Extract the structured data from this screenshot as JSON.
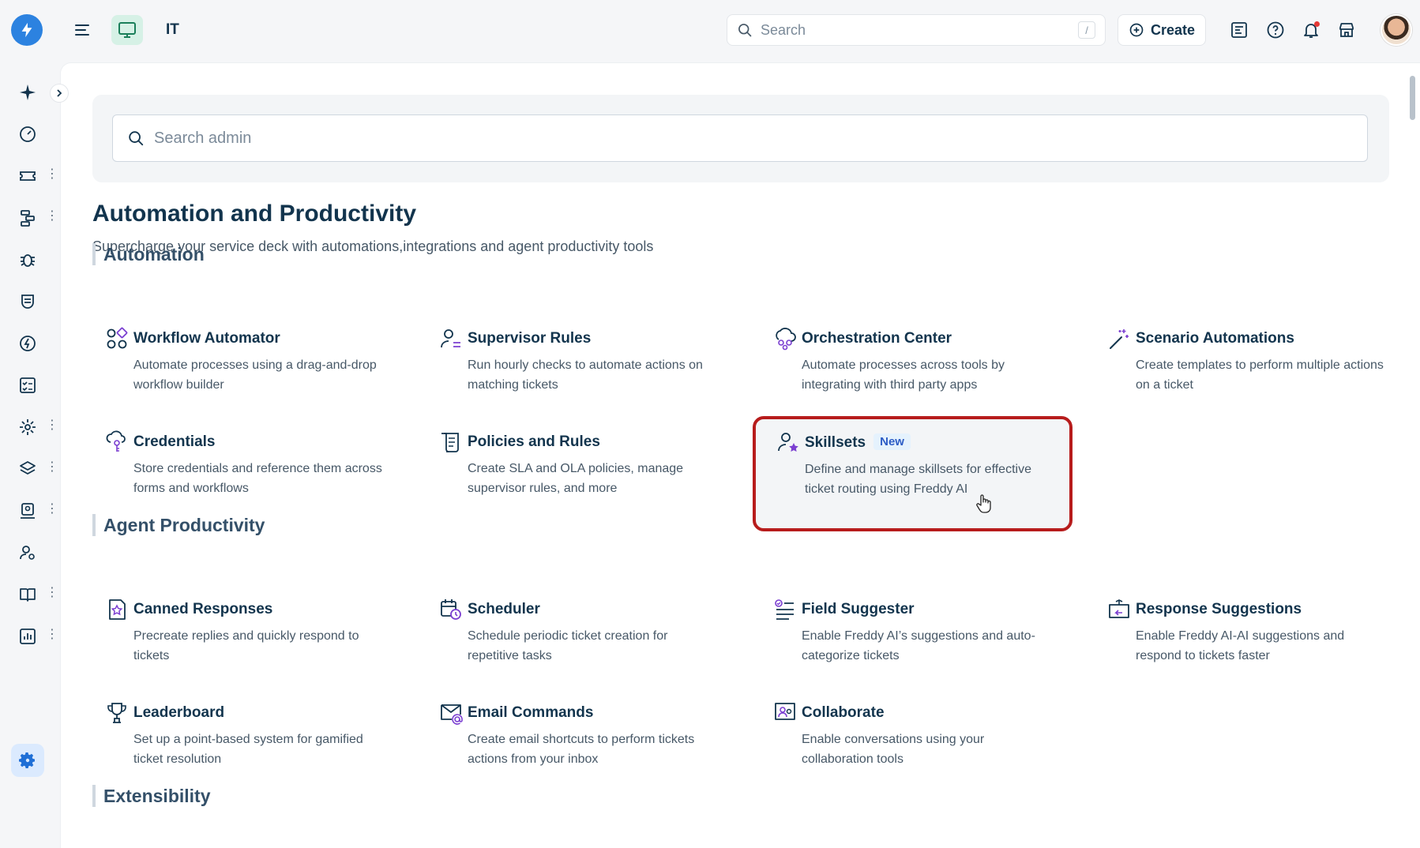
{
  "header": {
    "workspace_label": "IT",
    "search_placeholder": "Search",
    "search_shortcut": "/",
    "create_label": "Create"
  },
  "admin_search": {
    "placeholder": "Search admin"
  },
  "page": {
    "title": "Automation and Productivity",
    "subtitle": "Supercharge your service deck with automations,integrations and agent productivity tools"
  },
  "sections": {
    "automation": "Automation",
    "agent_productivity": "Agent Productivity",
    "extensibility": "Extensibility"
  },
  "automation_cards": [
    {
      "name": "Workflow Automator",
      "desc": "Automate processes using a drag-and-drop workflow builder",
      "icon": "workflow-icon"
    },
    {
      "name": "Supervisor Rules",
      "desc": "Run hourly checks to automate actions on matching tickets",
      "icon": "supervisor-icon"
    },
    {
      "name": "Orchestration Center",
      "desc": "Automate processes across tools by integrating with third party apps",
      "icon": "orchestration-icon"
    },
    {
      "name": "Scenario Automations",
      "desc": "Create templates to perform multiple actions on a ticket",
      "icon": "magic-wand-icon"
    },
    {
      "name": "Credentials",
      "desc": "Store credentials and reference them across forms and workflows",
      "icon": "credentials-icon"
    },
    {
      "name": "Policies and Rules",
      "desc": "Create SLA and OLA policies, manage supervisor rules, and more",
      "icon": "scroll-icon"
    },
    {
      "name": "Skillsets",
      "badge": "New",
      "desc": "Define and manage skillsets for effective ticket routing using Freddy AI",
      "icon": "skillset-icon"
    }
  ],
  "productivity_cards": [
    {
      "name": "Canned Responses",
      "desc": "Precreate replies and quickly respond to tickets",
      "icon": "canned-response-icon"
    },
    {
      "name": "Scheduler",
      "desc": "Schedule periodic ticket creation for repetitive tasks",
      "icon": "calendar-clock-icon"
    },
    {
      "name": "Field Suggester",
      "desc": "Enable Freddy AI’s suggestions and auto-categorize tickets",
      "icon": "field-suggester-icon"
    },
    {
      "name": "Response Suggestions",
      "desc": "Enable Freddy AI-AI suggestions and respond to tickets faster",
      "icon": "response-suggestion-icon"
    },
    {
      "name": "Leaderboard",
      "desc": "Set up a point-based system for gamified ticket resolution",
      "icon": "trophy-icon"
    },
    {
      "name": "Email Commands",
      "desc": "Create email shortcuts to perform tickets actions from your inbox",
      "icon": "email-command-icon"
    },
    {
      "name": "Collaborate",
      "desc": "Enable conversations using your collaboration tools",
      "icon": "collaborate-icon"
    }
  ],
  "colors": {
    "accent": "#2c82e0",
    "highlight_border": "#b71c1c",
    "icon_purple": "#7b3fd1",
    "text": "#12344d"
  }
}
